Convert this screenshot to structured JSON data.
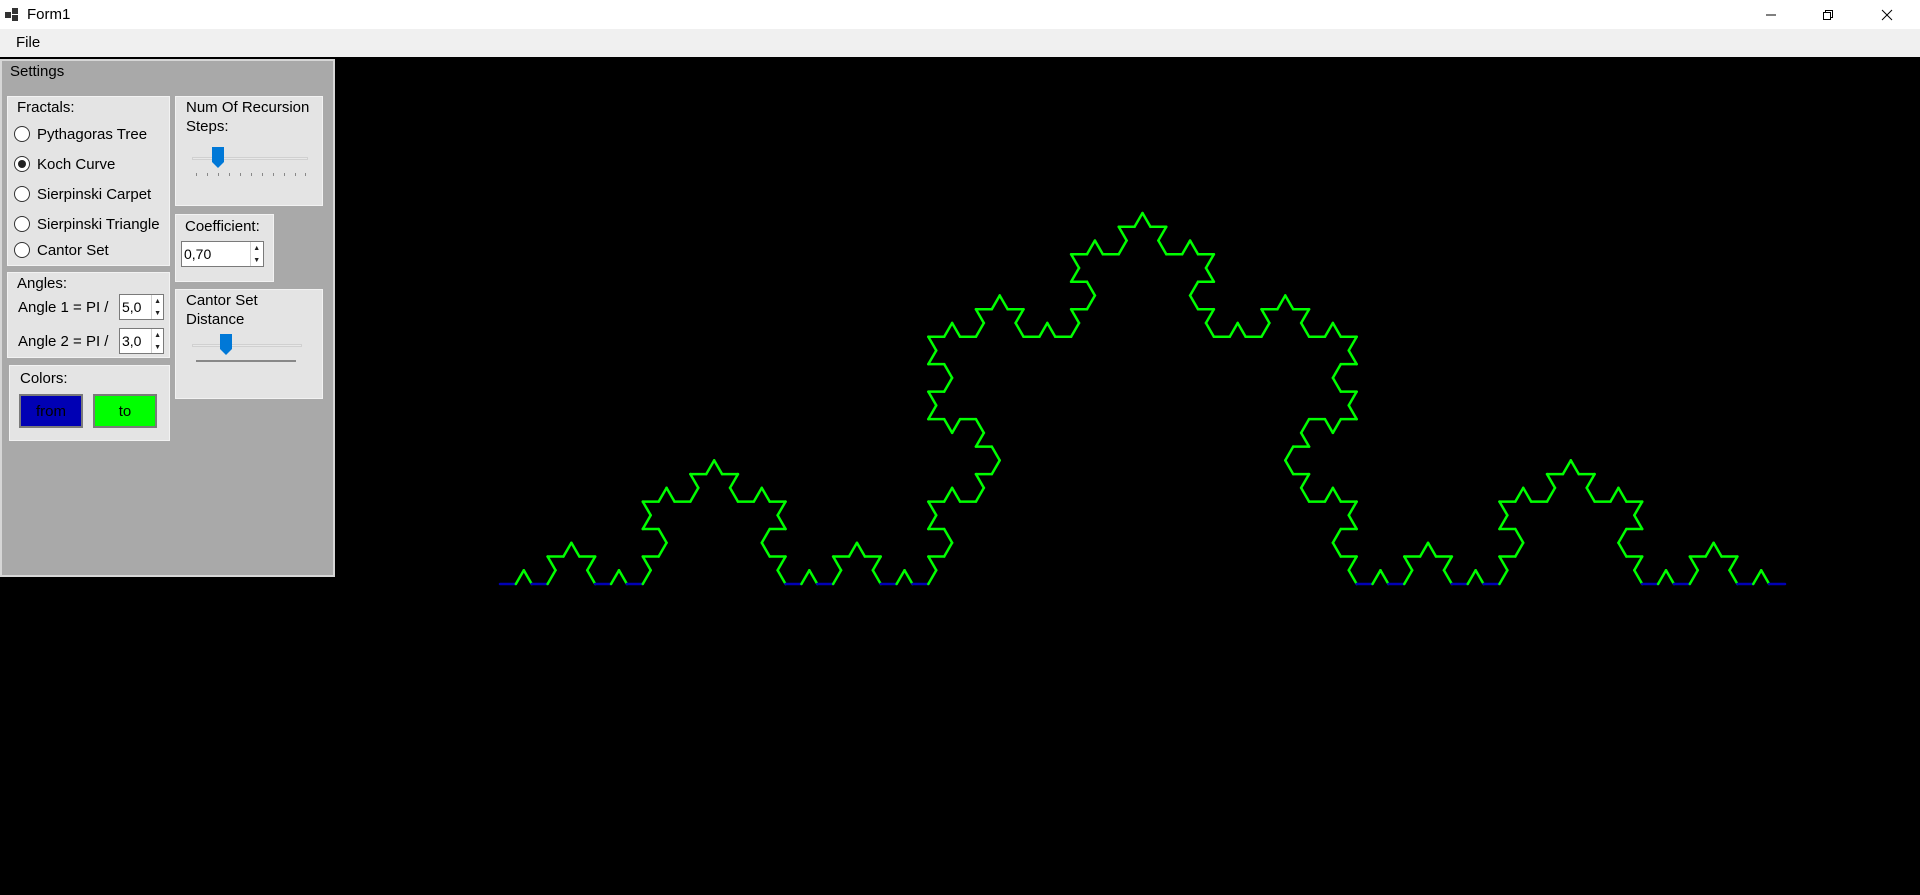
{
  "window": {
    "title": "Form1"
  },
  "menu": {
    "file_label": "File"
  },
  "settings": {
    "title": "Settings",
    "fractals": {
      "title": "Fractals:",
      "options": [
        "Pythagoras Tree",
        "Koch Curve",
        "Sierpinski Carpet",
        "Sierpinski Triangle",
        "Cantor Set"
      ],
      "selected": "Koch Curve"
    },
    "recursion": {
      "title_line1": "Num Of Recursion",
      "title_line2": "Steps:",
      "value_fraction": 0.2
    },
    "coefficient": {
      "title": "Coefficient:",
      "value": "0,70"
    },
    "angles": {
      "title": "Angles:",
      "angle1_label": "Angle 1 = PI /",
      "angle1_value": "5,0",
      "angle2_label": "Angle 2 = PI /",
      "angle2_value": "3,0"
    },
    "cantor": {
      "title_line1": "Cantor Set",
      "title_line2": "Distance",
      "value_fraction": 0.2
    },
    "colors": {
      "title": "Colors:",
      "from_label": "from",
      "from_color": "#0000b4",
      "to_label": "to",
      "to_color": "#00ff00"
    }
  },
  "fractal_render": {
    "type": "Koch Curve",
    "recursion_depth": 4,
    "start_color": "#0000b4",
    "end_color": "#00ff00"
  }
}
